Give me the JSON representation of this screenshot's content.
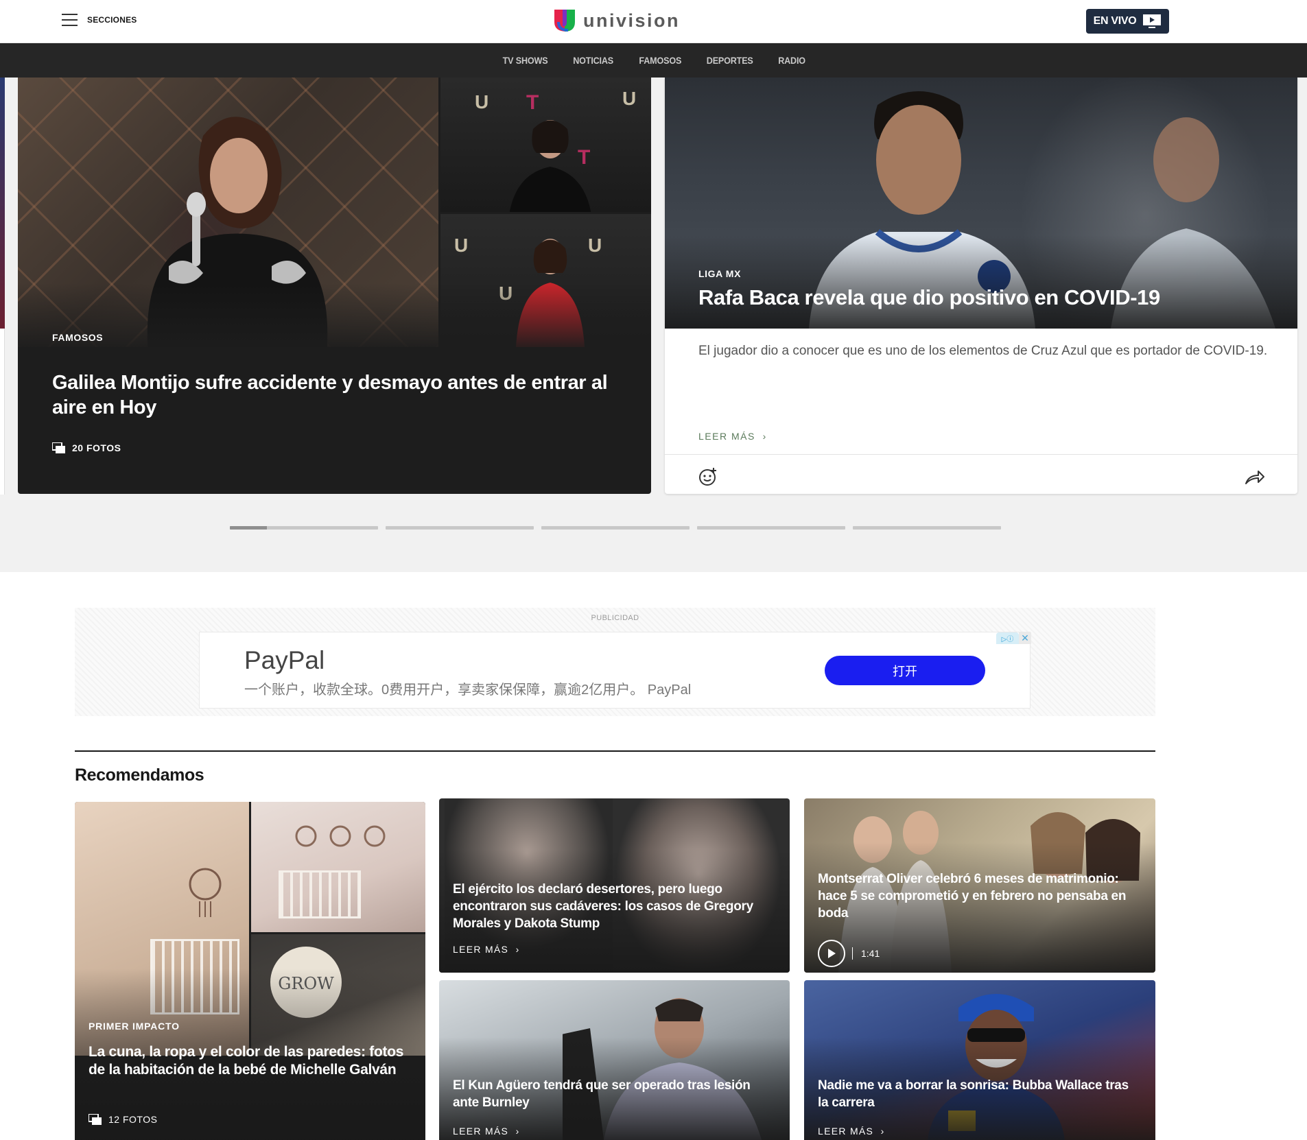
{
  "header": {
    "menu_label": "SECCIONES",
    "logo_text": "univision",
    "live_label": "EN VIVO"
  },
  "nav": {
    "items": [
      "TV SHOWS",
      "NOTICIAS",
      "FAMOSOS",
      "DEPORTES",
      "RADIO"
    ]
  },
  "carousel": {
    "slide_a": {
      "kicker": "FAMOSOS",
      "title": "Galilea Montijo sufre accidente y desmayo antes de entrar al aire en Hoy",
      "photo_count": "20 FOTOS"
    },
    "slide_b": {
      "kicker": "LIGA MX",
      "title": "Rafa Baca revela que dio positivo en COVID-19",
      "description": "El jugador dio a conocer que es uno de los elementos de Cruz Azul que es portador de COVID-19.",
      "more": "LEER MÁS"
    },
    "pager": {
      "count": 5,
      "active_index": 0,
      "active_progress": 0.25
    }
  },
  "ad": {
    "label": "PUBLICIDAD",
    "brand": "PayPal",
    "copy": "一个账户，收款全球。0费用开户，享卖家保保障，赢逾2亿用户。 PayPal",
    "cta": "打开"
  },
  "recommended": {
    "title": "Recomendamos",
    "cards": [
      {
        "kicker": "PRIMER IMPACTO",
        "title": "La cuna, la ropa y el color de las paredes: fotos de la habitación de la bebé de Michelle Galván",
        "photo_count": "12 FOTOS"
      },
      {
        "title": "El ejército los declaró desertores, pero luego encontraron sus cadáveres: los casos de Gregory Morales y Dakota Stump",
        "more": "LEER MÁS"
      },
      {
        "title": "Montserrat Oliver celebró 6 meses de matrimonio: hace 5 se comprometió y en febrero no pensaba en boda",
        "duration": "1:41"
      },
      {
        "title": "El Kun Agüero tendrá que ser operado tras lesión ante Burnley",
        "more": "LEER MÁS"
      },
      {
        "title": "Nadie me va a borrar la sonrisa: Bubba Wallace tras la carrera",
        "more": "LEER MÁS"
      }
    ]
  },
  "colors": {
    "live_button": "#1f2c40",
    "nav_background": "#262626",
    "ad_cta": "#1a1ef0",
    "dark_card": "#1d1d1d"
  },
  "icons": [
    "hamburger-icon",
    "tv-play-icon",
    "gallery-icon",
    "reaction-icon",
    "share-icon",
    "play-icon",
    "chevron-right-icon",
    "adchoices-icon",
    "close-icon"
  ]
}
